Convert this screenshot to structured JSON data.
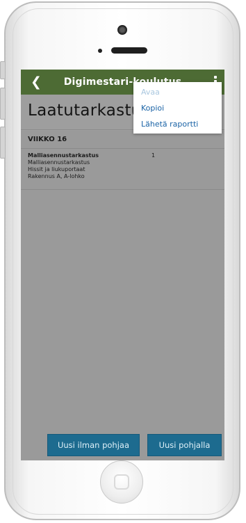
{
  "app": {
    "title": "Digimestari-koulutus"
  },
  "colors": {
    "topbar": "#4d6b34",
    "accent": "#1d6b8f",
    "link": "#1a63a6",
    "disabled_link": "#a9c7df",
    "screen_overlay": "#9a9a9a"
  },
  "icons": {
    "back": "chevron-left-icon",
    "menu": "more-vertical-icon",
    "refresh": "refresh-icon",
    "filter": "sliders-icon"
  },
  "header": {
    "page_title": "Laatutarkastu…"
  },
  "list": {
    "section_label": "VIIKKO 16",
    "items": [
      {
        "line1": "Malliasennustarkastus",
        "line2": "Malliasennustarkastus",
        "line3": "Hissit ja liukuportaat",
        "line4": "Rakennus A, A-lohko",
        "number": "1"
      }
    ]
  },
  "context_menu": {
    "items": [
      {
        "label": "Avaa",
        "enabled": false
      },
      {
        "label": "Kopioi",
        "enabled": true
      },
      {
        "label": "Lähetä raportti",
        "enabled": true
      }
    ]
  },
  "footer": {
    "new_without_template": "Uusi ilman pohjaa",
    "new_with_template": "Uusi pohjalla"
  }
}
